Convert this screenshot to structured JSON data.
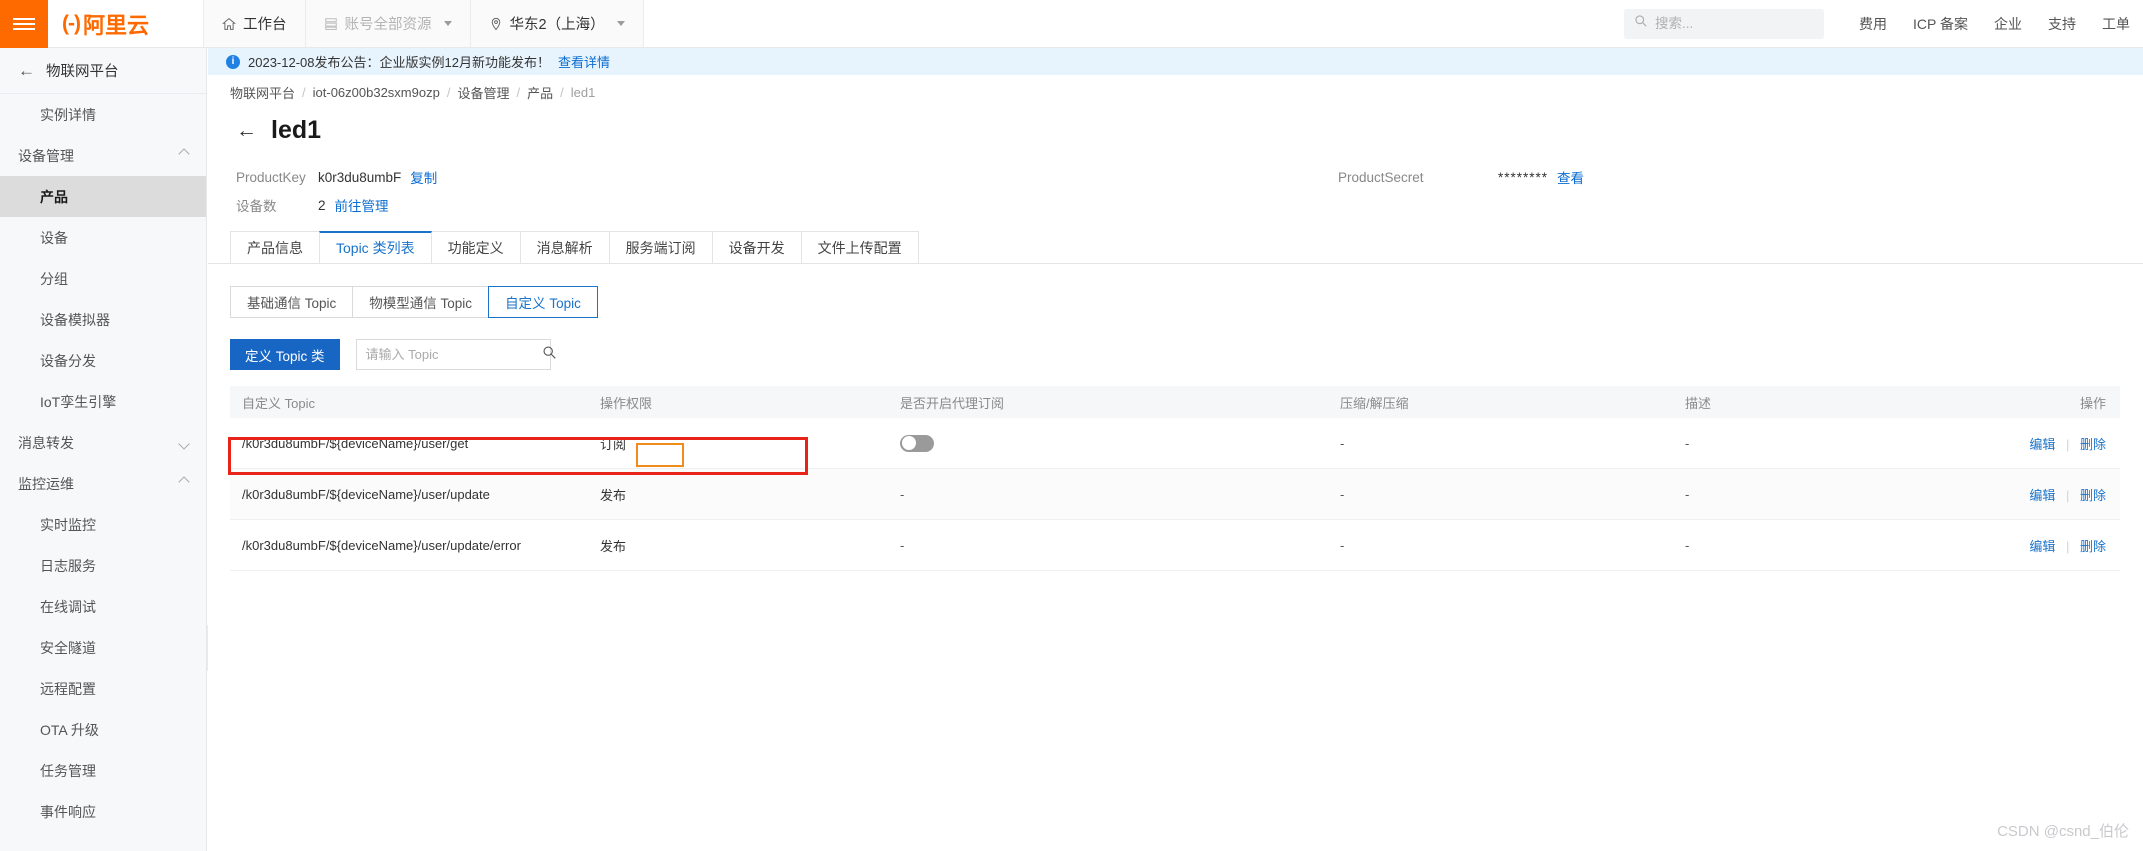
{
  "header": {
    "hamburger_icon": "hamburger-icon",
    "brand": {
      "mark": "(-)",
      "text": "阿里云"
    },
    "nav": [
      {
        "label": "工作台",
        "icon": "home-icon",
        "muted": false,
        "caret": false
      },
      {
        "label": "账号全部资源",
        "icon": "resource-icon",
        "muted": true,
        "caret": true
      },
      {
        "label": "华东2（上海）",
        "icon": "location-pin-icon",
        "muted": false,
        "caret": true
      }
    ],
    "search": {
      "placeholder": "搜索...",
      "value": "",
      "icon": "search-icon"
    },
    "right_links": [
      "费用",
      "ICP 备案",
      "企业",
      "支持",
      "工单"
    ]
  },
  "sidebar": {
    "title": "物联网平台",
    "back_icon": "back-arrow-icon",
    "items": [
      {
        "type": "link",
        "label": "实例详情",
        "indent": false,
        "active": false
      },
      {
        "type": "group",
        "label": "设备管理",
        "expanded": true
      },
      {
        "type": "link",
        "label": "产品",
        "indent": true,
        "active": true
      },
      {
        "type": "link",
        "label": "设备",
        "indent": true,
        "active": false
      },
      {
        "type": "link",
        "label": "分组",
        "indent": true,
        "active": false
      },
      {
        "type": "link",
        "label": "设备模拟器",
        "indent": true,
        "active": false
      },
      {
        "type": "link",
        "label": "设备分发",
        "indent": true,
        "active": false
      },
      {
        "type": "link",
        "label": "IoT孪生引擎",
        "indent": true,
        "active": false
      },
      {
        "type": "group",
        "label": "消息转发",
        "expanded": false
      },
      {
        "type": "group",
        "label": "监控运维",
        "expanded": true
      },
      {
        "type": "link",
        "label": "实时监控",
        "indent": true,
        "active": false
      },
      {
        "type": "link",
        "label": "日志服务",
        "indent": true,
        "active": false
      },
      {
        "type": "link",
        "label": "在线调试",
        "indent": true,
        "active": false
      },
      {
        "type": "link",
        "label": "安全隧道",
        "indent": true,
        "active": false
      },
      {
        "type": "link",
        "label": "远程配置",
        "indent": true,
        "active": false
      },
      {
        "type": "link",
        "label": "OTA 升级",
        "indent": true,
        "active": false
      },
      {
        "type": "link",
        "label": "任务管理",
        "indent": true,
        "active": false
      },
      {
        "type": "link",
        "label": "事件响应",
        "indent": true,
        "active": false
      }
    ],
    "collapse_icon": "chevron-left-icon"
  },
  "notice": {
    "icon": "info-icon",
    "text": "2023-12-08发布公告：企业版实例12月新功能发布！",
    "link": "查看详情"
  },
  "breadcrumb": [
    "物联网平台",
    "iot-06z00b32sxm9ozp",
    "设备管理",
    "产品",
    "led1"
  ],
  "page": {
    "back_icon": "back-arrow-icon",
    "title": "led1",
    "product_key_label": "ProductKey",
    "product_key_value": "k0r3du8umbF",
    "product_key_action": "复制",
    "device_count_label": "设备数",
    "device_count_value": "2",
    "device_count_action": "前往管理",
    "product_secret_label": "ProductSecret",
    "product_secret_value": "********",
    "product_secret_action": "查看"
  },
  "tabs": [
    {
      "label": "产品信息",
      "active": false
    },
    {
      "label": "Topic 类列表",
      "active": true
    },
    {
      "label": "功能定义",
      "active": false
    },
    {
      "label": "消息解析",
      "active": false
    },
    {
      "label": "服务端订阅",
      "active": false
    },
    {
      "label": "设备开发",
      "active": false
    },
    {
      "label": "文件上传配置",
      "active": false
    }
  ],
  "segments": [
    {
      "label": "基础通信 Topic",
      "active": false
    },
    {
      "label": "物模型通信 Topic",
      "active": false
    },
    {
      "label": "自定义 Topic",
      "active": true
    }
  ],
  "toolbar": {
    "define_topic_button": "定义 Topic 类",
    "search_placeholder": "请输入 Topic",
    "search_value": "",
    "search_icon": "search-icon"
  },
  "table": {
    "columns": [
      "自定义 Topic",
      "操作权限",
      "是否开启代理订阅",
      "压缩/解压缩",
      "描述",
      "操作"
    ],
    "rows": [
      {
        "topic": "/k0r3du8umbF/${deviceName}/user/get",
        "permission": "订阅",
        "proxy_subscribe": "toggle-off",
        "compression": "-",
        "description": "-",
        "edit": "编辑",
        "delete": "删除"
      },
      {
        "topic": "/k0r3du8umbF/${deviceName}/user/update",
        "permission": "发布",
        "proxy_subscribe": "-",
        "compression": "-",
        "description": "-",
        "edit": "编辑",
        "delete": "删除"
      },
      {
        "topic": "/k0r3du8umbF/${deviceName}/user/update/error",
        "permission": "发布",
        "proxy_subscribe": "-",
        "compression": "-",
        "description": "-",
        "edit": "编辑",
        "delete": "删除"
      }
    ]
  },
  "annotations": {
    "red_box_color": "#e8231a",
    "orange_box_color": "#f08c1b"
  },
  "watermark": "CSDN @csnd_伯伦",
  "colors": {
    "brand_orange": "#ff6a00",
    "link_blue": "#0a6cd2",
    "primary_blue": "#1766c4",
    "tab_active_blue": "#1a73c9"
  }
}
